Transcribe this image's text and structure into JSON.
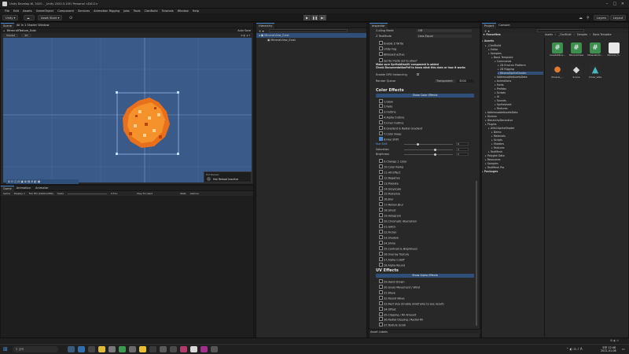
{
  "window": {
    "title": "Unity Develop W, 2020 - _Unity 2020.3.10f1 Personal <DX11>"
  },
  "menu": [
    "File",
    "Edit",
    "Assets",
    "GameObject",
    "Component",
    "Services",
    "Animation Rigging",
    "Jobs",
    "Tools",
    "ClanBuild",
    "Tutorials",
    "Window",
    "Help"
  ],
  "toolbar": {
    "account": "Unity",
    "cloud": "☁",
    "asset_store": "Asset Store",
    "layers": "Layers",
    "layout": "Layout"
  },
  "scene": {
    "tabs": [
      "Scene",
      "All In 1 Shader Window"
    ],
    "breadcrumb": "MinecraftTexture_Exist",
    "auto_save": "Auto Save",
    "shading": "Shaded",
    "mode": "2D",
    "hot_reload_title": "Hot Reload",
    "hot_reload_status": "Hot Reload Inactive"
  },
  "game": {
    "tabs": [
      "Game",
      "Animation",
      "Animator"
    ],
    "display": "Display 1",
    "resolution": "Full HD (1920x1080)",
    "scale_label": "Scale",
    "scale_value": "0.51x",
    "play_mode": "Play Focused",
    "stats": "Stats",
    "gizmos": "Gizmos"
  },
  "hierarchy": {
    "tab": "Hierarchy",
    "root": "MineralView_Exist",
    "child": "MineralView_Exist"
  },
  "inspector": {
    "tab": "Inspector",
    "culling_mode_label": "Culling Mode",
    "culling_mode_value": "Off",
    "z_test_label": "Z TestMode",
    "z_test_value": "Less Equal",
    "lines": [
      "Enable Z Write",
      "Unity Fog",
      "Billboard active"
    ],
    "sprite_mode_label": "Sprite mode set to atlas?",
    "warning": "Make sure SpriteAtlasUV component is added",
    "warning2": "Check DocumentationPdf to know what this does or how it works",
    "gpu_label": "Enable GPU Instancing",
    "render_queue_label": "Render Queue",
    "render_queue_mode": "Transparent",
    "render_queue_value": "3000",
    "color_effects_title": "Color Effects",
    "show_color_effects": "Show Color Effects",
    "color_effects": [
      {
        "label": "1.Glow",
        "on": false
      },
      {
        "label": "2.Fade",
        "on": false
      },
      {
        "label": "3.Outline",
        "on": false
      },
      {
        "label": "4.Alpha Outline",
        "on": false
      },
      {
        "label": "5.Inner Outline",
        "on": false
      },
      {
        "label": "6.Gradient & Radial Gradient",
        "on": false
      },
      {
        "label": "7.Color Swap",
        "on": false
      },
      {
        "label": "8.Hue Shift",
        "on": true
      }
    ],
    "hue_shift_label": "Hue Shift",
    "hue_shift_value": "0",
    "saturation_label": "Saturation",
    "saturation_value": "1",
    "brightness_label": "Brightness",
    "brightness_value": "1",
    "color_effects_2": [
      "9.Change 1 Color",
      "10.Color Ramp",
      "11.Hit Effect",
      "12.Negative",
      "13.Pixelate",
      "14.Greyscale",
      "15.Posterize",
      "16.Blur",
      "17.Motion Blur",
      "18.Ghost",
      "19.Hologram",
      "20.Chromatic Aberration",
      "21.Glitch",
      "22.Flicker",
      "23.Shadow",
      "24.Shine",
      "25.Contrast & Brightness",
      "26.Overlay Texture",
      "27.Alpha Cutoff",
      "28.Alpha Round"
    ],
    "uv_effects_title": "UV Effects",
    "show_alpha_effects": "Show Alpha Effects",
    "uv_effects": [
      "29.Hand Drawn",
      "30.Grass Movement / Wind",
      "31.Wave",
      "32.Round Wave",
      "33.Rect Size (Enable wireframe to see result)",
      "34.Offset",
      "35.Clipping / Fill Amount",
      "36.Radial Clipping / Radial Fill",
      "37.Texture Scroll"
    ],
    "asset_labels": "Asset Labels"
  },
  "project": {
    "tabs": [
      "Project",
      "Console"
    ],
    "breadcrumb": [
      "Assets",
      "_ClanBuild",
      "Samples",
      "Basic Template"
    ],
    "favorites": "Favorites",
    "tree": [
      "Assets",
      "_ClanBuild",
      "Editor",
      "Samples",
      "Basic Template",
      "Commands",
      "2D Environ Platform",
      "2D Rigging",
      "MineralSpriteShader",
      "AddressableAssetsData",
      "Animations",
      "Fonts",
      "Prefabs",
      "Scripts",
      "UI",
      "Sounds",
      "Spritesheet",
      "Textures",
      "AddressableAssetsData",
      "Gizmos",
      "HierarchyDecorator",
      "Plugins",
      "AllIn1SpriteShader",
      "Demo",
      "Materials",
      "Scripts",
      "Shaders",
      "Textures",
      "TextMesh",
      "Polyglot Data",
      "Resources",
      "Samples",
      "TextMesh Pro",
      "Packages"
    ],
    "assets": [
      {
        "label": "CreateMine...",
        "color": "#3d8f4e",
        "glyph": "#"
      },
      {
        "label": "MineralView",
        "color": "#3d8f4e",
        "glyph": "#"
      },
      {
        "label": "MineralInfo...",
        "color": "#3d8f4e",
        "glyph": "#"
      },
      {
        "label": "Mineral_T...",
        "color": "#e8e8e8",
        "glyph": ""
      },
      {
        "label": "Mineral_...",
        "color": "#e07a2e",
        "glyph": "●"
      },
      {
        "label": "Scene",
        "color": "#d8d8d8",
        "glyph": "◆"
      },
      {
        "label": "Crisis_Vate",
        "color": "#46b8c0",
        "glyph": "▲"
      }
    ]
  },
  "statusbar": {
    "text": ""
  },
  "taskbar": {
    "search": "검색",
    "time": "오후 12:48",
    "date": "2021-01-08"
  }
}
